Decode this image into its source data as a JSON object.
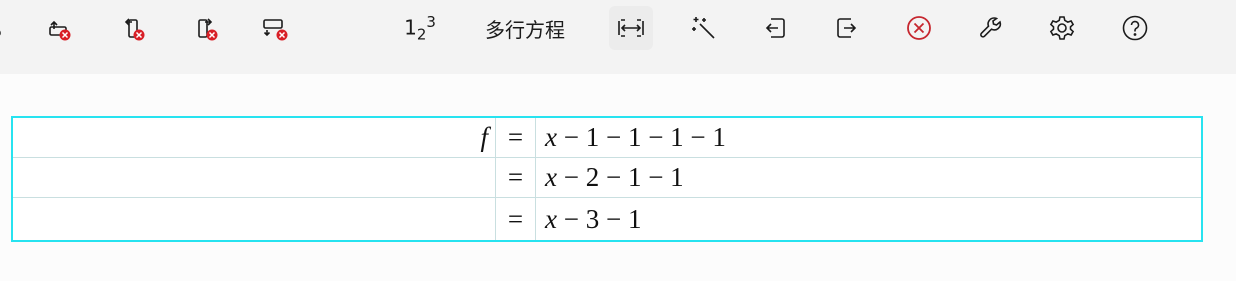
{
  "toolbar": {
    "numbering_base": "1",
    "numbering_sub": "2",
    "numbering_sup": "3",
    "multiline_label": "多行方程",
    "icons": [
      "cut-icon",
      "delete-row-above-icon",
      "delete-column-left-icon",
      "delete-column-right-icon",
      "delete-row-below-icon",
      "equation-numbering-icon",
      "fit-width-icon",
      "magic-wand-icon",
      "align-left-icon",
      "align-right-icon",
      "close-circle-icon",
      "wrench-icon",
      "gear-icon",
      "help-icon"
    ],
    "colors": {
      "delete_badge": "#d81f26",
      "close_red": "#c6262e"
    }
  },
  "equations": [
    {
      "lhs": "f",
      "rel": "=",
      "rhs_var": "x",
      "rhs_rest": "− 1 − 1 − 1 − 1"
    },
    {
      "lhs": "",
      "rel": "=",
      "rhs_var": "x",
      "rhs_rest": "− 2 − 1 − 1"
    },
    {
      "lhs": "",
      "rel": "=",
      "rhs_var": "x",
      "rhs_rest": "− 3 − 1"
    }
  ],
  "colors": {
    "selection_border": "#27e3f0",
    "grid_line": "#c9dfe0"
  }
}
